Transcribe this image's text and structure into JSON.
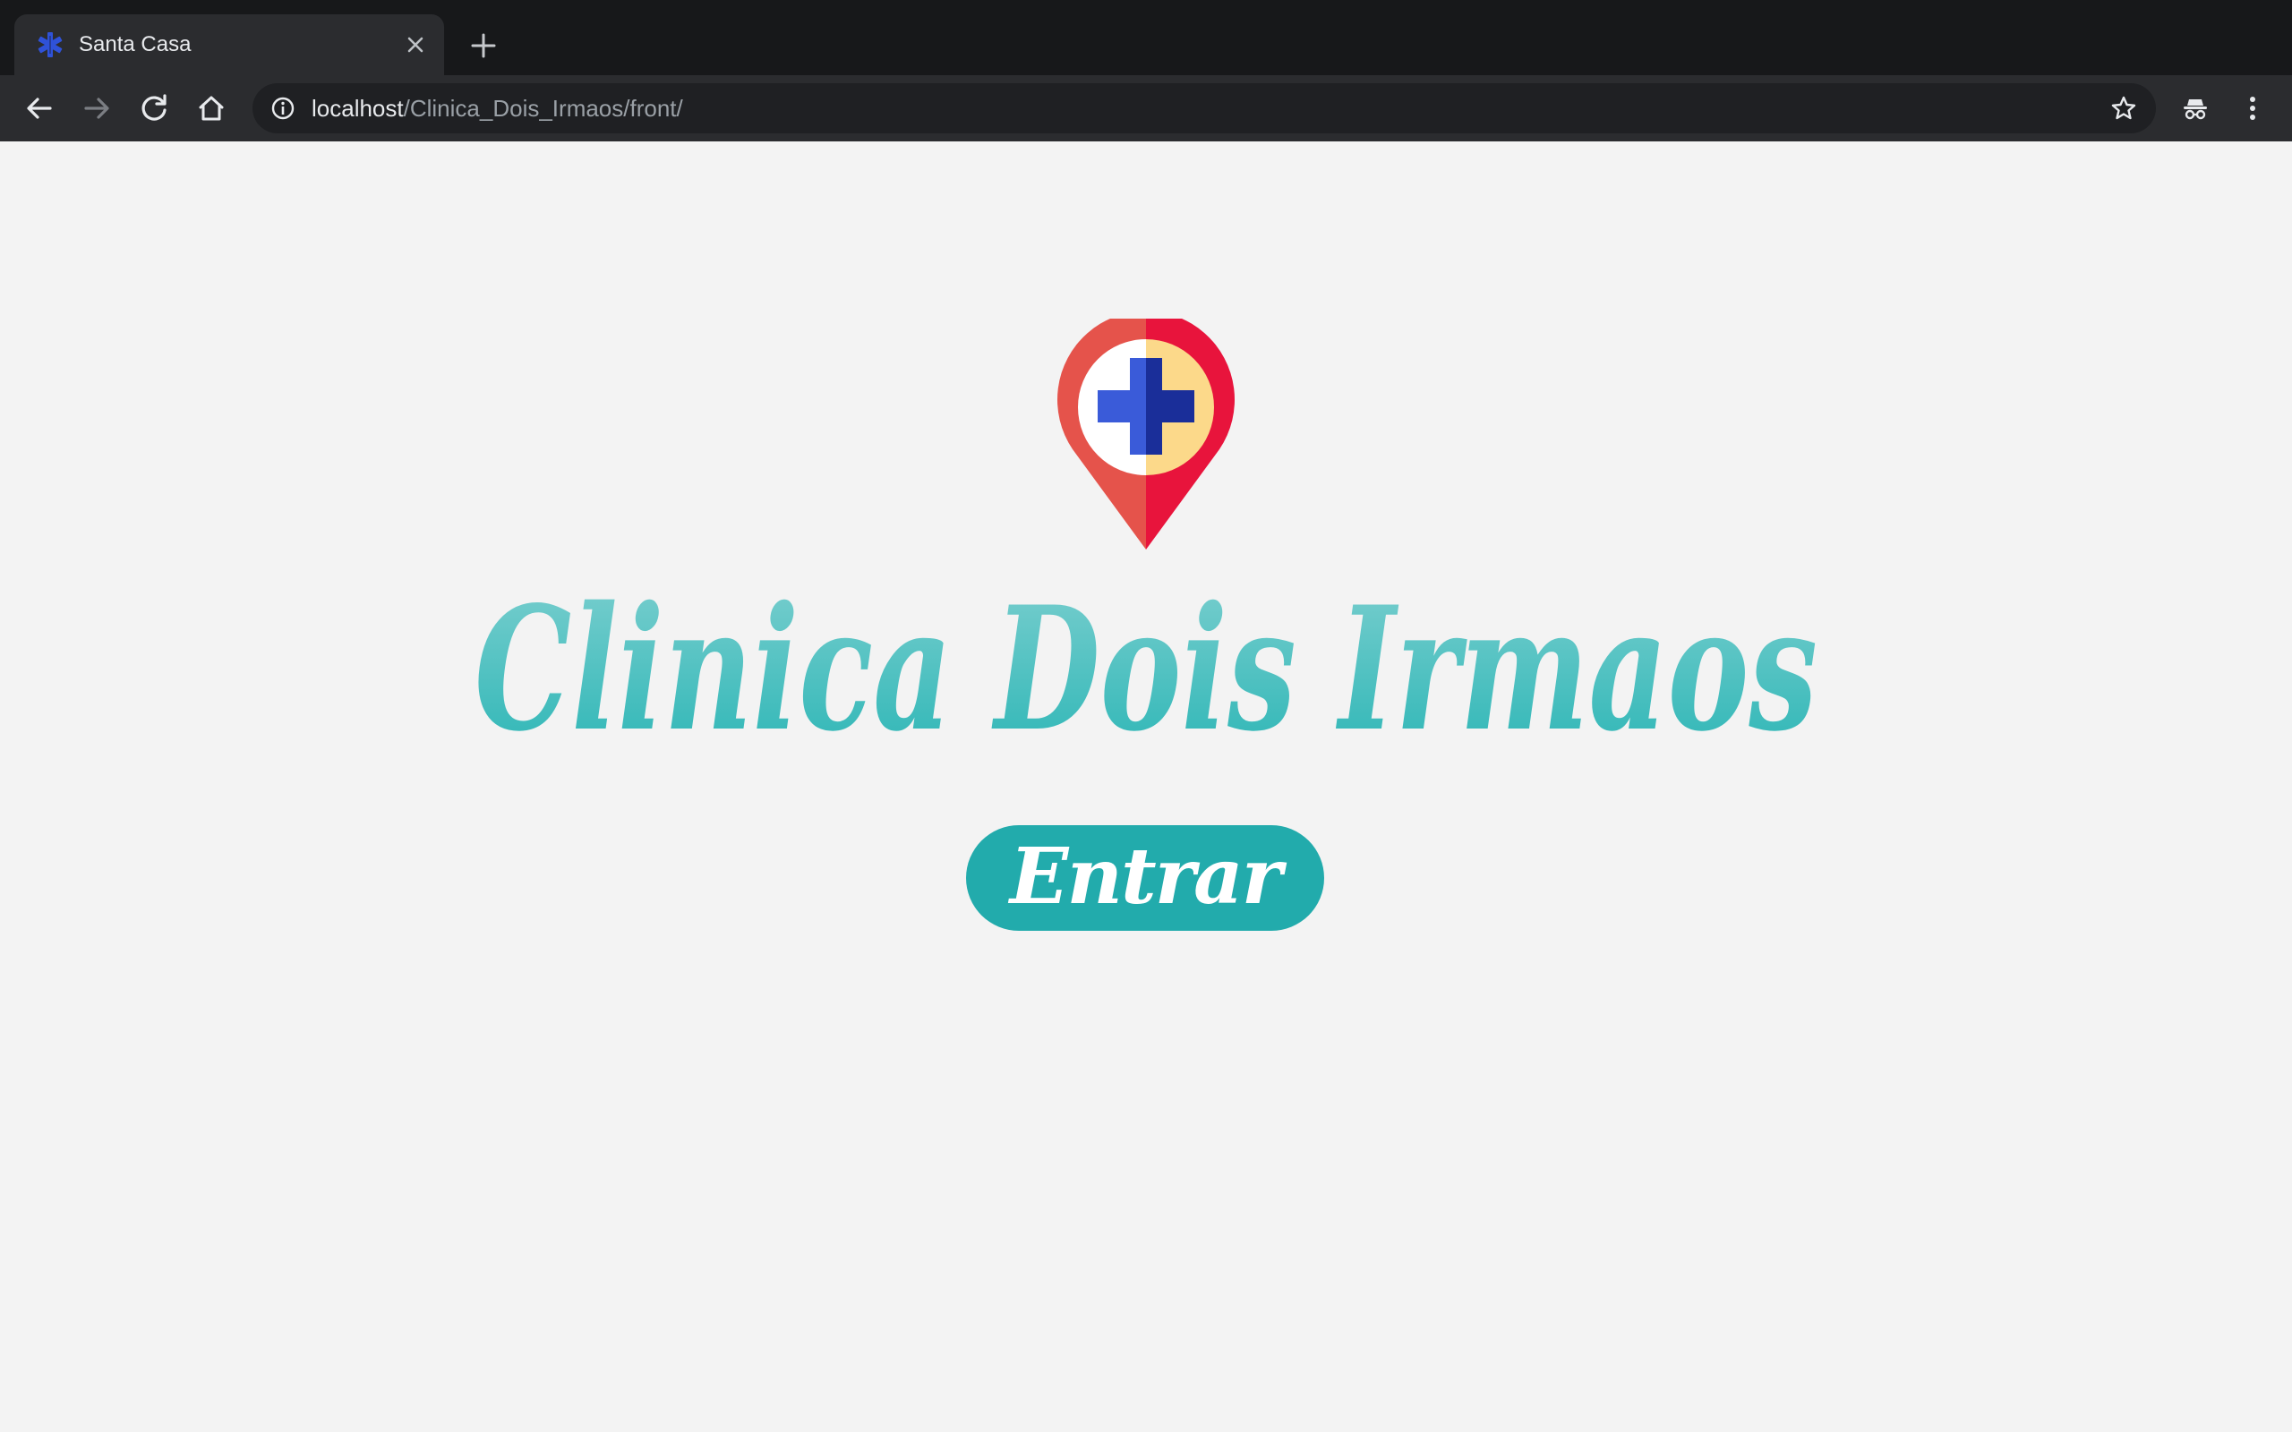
{
  "browser": {
    "tab": {
      "title": "Santa Casa",
      "favicon": "medical-star-icon",
      "close_icon": "close-icon"
    },
    "new_tab_icon": "plus-icon",
    "toolbar": {
      "back_icon": "arrow-left-icon",
      "forward_icon": "arrow-right-icon",
      "reload_icon": "reload-icon",
      "home_icon": "home-icon",
      "info_icon": "info-icon",
      "star_icon": "star-icon",
      "incognito_icon": "incognito-icon",
      "menu_icon": "kebab-menu-icon"
    },
    "address": {
      "host": "localhost",
      "path": "/Clinica_Dois_Irmaos/front/"
    }
  },
  "page": {
    "logo_icon": "medical-location-pin-icon",
    "title": "Clinica Dois Irmaos",
    "enter_button": "Entrar"
  },
  "colors": {
    "accent": "#22abac",
    "title_gradient_top": "#7ccfcf",
    "title_gradient_bottom": "#2ab5b5",
    "pin_left": "#e5534b",
    "pin_right": "#e8143c",
    "pin_inner_left": "#ffffff",
    "pin_inner_right": "#fcd98a",
    "cross_left": "#3a5bd9",
    "cross_right": "#1a2e99",
    "page_background": "#f3f3f3",
    "browser_chrome": "#2b2c2f"
  }
}
